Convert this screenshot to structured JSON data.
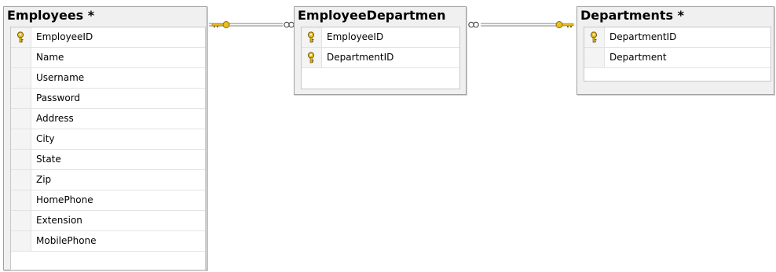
{
  "tables": {
    "employees": {
      "title": "Employees *",
      "columns": [
        {
          "name": "EmployeeID",
          "primary_key": true
        },
        {
          "name": "Name",
          "primary_key": false
        },
        {
          "name": "Username",
          "primary_key": false
        },
        {
          "name": "Password",
          "primary_key": false
        },
        {
          "name": "Address",
          "primary_key": false
        },
        {
          "name": "City",
          "primary_key": false
        },
        {
          "name": "State",
          "primary_key": false
        },
        {
          "name": "Zip",
          "primary_key": false
        },
        {
          "name": "HomePhone",
          "primary_key": false
        },
        {
          "name": "Extension",
          "primary_key": false
        },
        {
          "name": "MobilePhone",
          "primary_key": false
        }
      ]
    },
    "employee_department": {
      "title": "EmployeeDepartmen",
      "columns": [
        {
          "name": "EmployeeID",
          "primary_key": true
        },
        {
          "name": "DepartmentID",
          "primary_key": true
        }
      ]
    },
    "departments": {
      "title": "Departments *",
      "columns": [
        {
          "name": "DepartmentID",
          "primary_key": true
        },
        {
          "name": "Department",
          "primary_key": false
        }
      ]
    }
  },
  "relationships": [
    {
      "from": "Employees",
      "from_end": "key",
      "to": "EmployeeDepartmen",
      "to_end": "infinity"
    },
    {
      "from": "EmployeeDepartmen",
      "from_end": "infinity",
      "to": "Departments",
      "to_end": "key"
    }
  ],
  "colors": {
    "key_icon": "#e8c020",
    "connector_line": "#808080",
    "table_bg": "#f0f0f0",
    "table_border": "#a0a0a0"
  }
}
